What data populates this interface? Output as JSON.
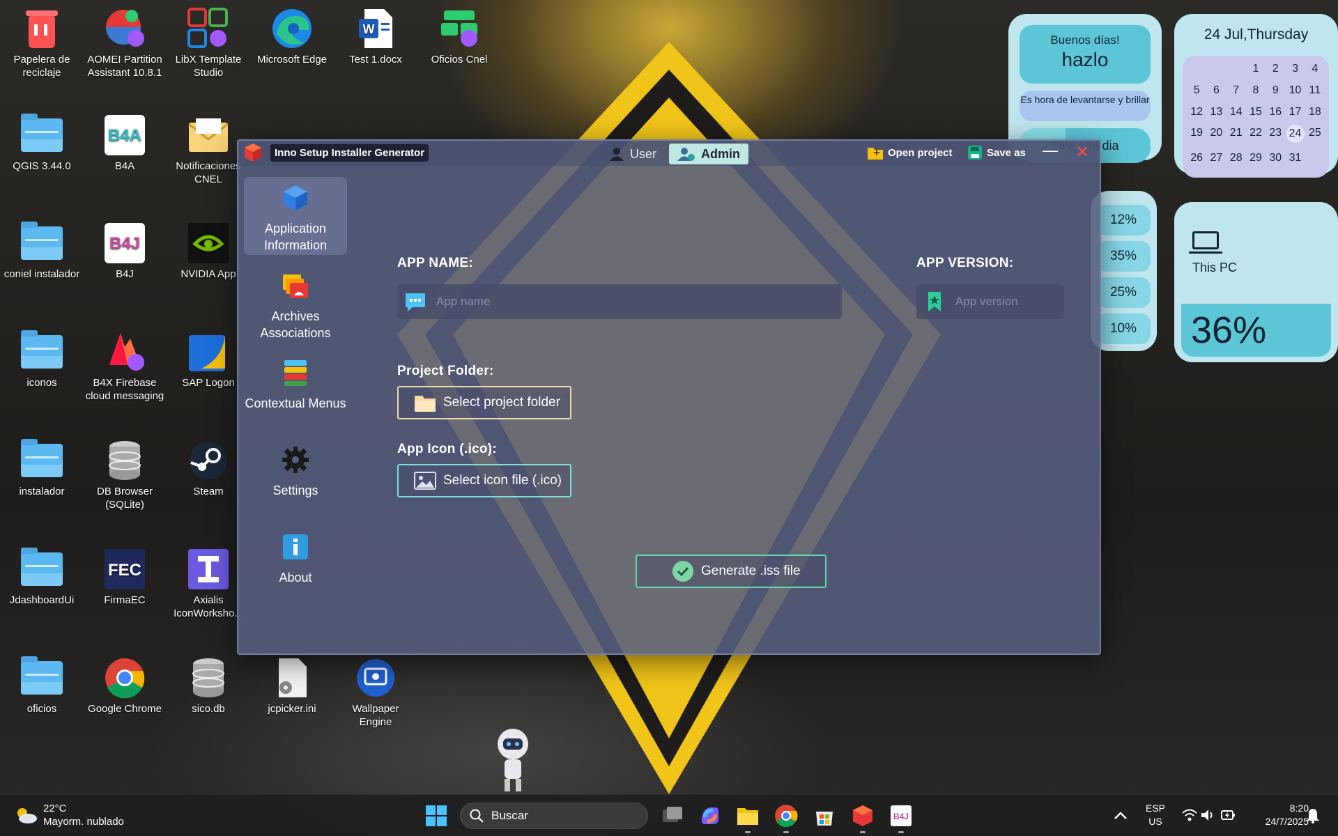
{
  "desktop": {
    "icons": [
      {
        "label": "Papelera de reciclaje",
        "icon": "recycle-bin-icon"
      },
      {
        "label": "AOMEI Partition Assistant 10.8.1",
        "icon": "aomei-icon"
      },
      {
        "label": "LibX Template Studio",
        "icon": "libx-icon"
      },
      {
        "label": "Microsoft Edge",
        "icon": "edge-icon"
      },
      {
        "label": "Test 1.docx",
        "icon": "word-doc-icon"
      },
      {
        "label": "Oficios Cnel",
        "icon": "oficios-app-icon"
      },
      {
        "label": "QGIS 3.44.0",
        "icon": "folder-icon"
      },
      {
        "label": "B4A",
        "icon": "b4a-icon"
      },
      {
        "label": "Notificaciones CNEL",
        "icon": "mail-icon"
      },
      {
        "label": "coniel instalador",
        "icon": "folder-icon"
      },
      {
        "label": "B4J",
        "icon": "b4j-icon"
      },
      {
        "label": "NVIDIA App",
        "icon": "nvidia-icon"
      },
      {
        "label": "iconos",
        "icon": "folder-icon"
      },
      {
        "label": "B4X Firebase cloud messaging",
        "icon": "firebase-icon"
      },
      {
        "label": "SAP Logon",
        "icon": "sap-icon"
      },
      {
        "label": "instalador",
        "icon": "folder-icon"
      },
      {
        "label": "DB Browser (SQLite)",
        "icon": "database-icon"
      },
      {
        "label": "Steam",
        "icon": "steam-icon"
      },
      {
        "label": "JdashboardUi",
        "icon": "folder-icon"
      },
      {
        "label": "FirmaEC",
        "icon": "firmaec-icon"
      },
      {
        "label": "Axialis IconWorksho...",
        "icon": "axialis-icon"
      },
      {
        "label": "oficios",
        "icon": "folder-icon"
      },
      {
        "label": "Google Chrome",
        "icon": "chrome-icon"
      },
      {
        "label": "sico.db",
        "icon": "database-icon"
      },
      {
        "label": "jcpicker.ini",
        "icon": "ini-file-icon"
      },
      {
        "label": "Wallpaper Engine",
        "icon": "wallpaper-engine-icon"
      }
    ]
  },
  "widgets": {
    "greeting": {
      "line1": "Buenos días!",
      "line2": "hazlo",
      "line3": "Es hora de levantarse y brillar",
      "progress_label": "35% Del dia",
      "progress": 0.35
    },
    "calendar": {
      "header": "24 Jul,Thursday",
      "days": [
        "",
        "",
        "",
        "1",
        "2",
        "3",
        "4",
        "5",
        "6",
        "7",
        "8",
        "9",
        "10",
        "11",
        "12",
        "13",
        "14",
        "15",
        "16",
        "17",
        "18",
        "19",
        "20",
        "21",
        "22",
        "23",
        "24",
        "25",
        "26",
        "27",
        "28",
        "29",
        "30",
        "31"
      ],
      "today": "24"
    },
    "performance": {
      "values": [
        "12%",
        "35%",
        "25%",
        "10%"
      ]
    },
    "this_pc": {
      "label": "This PC",
      "value": "36%"
    }
  },
  "app": {
    "title": "Inno Setup Installer Generator",
    "modes": {
      "user": "User",
      "admin": "Admin",
      "active": "admin"
    },
    "actions": {
      "open_project": "Open project",
      "save_as": "Save as"
    },
    "window_controls": {
      "minimize": "—",
      "close": "✕"
    },
    "sidebar": [
      {
        "label": "Application Information",
        "icon": "cube-icon",
        "active": true
      },
      {
        "label": "Archives Associations",
        "icon": "files-icon",
        "active": false
      },
      {
        "label": "Contextual Menus",
        "icon": "stack-menu-icon",
        "active": false
      },
      {
        "label": "Settings",
        "icon": "gear-icon",
        "active": false
      },
      {
        "label": "About",
        "icon": "info-icon",
        "active": false
      }
    ],
    "form": {
      "app_name_label": "APP NAME:",
      "app_name_placeholder": "App name",
      "app_name_value": "",
      "app_version_label": "APP VERSION:",
      "app_version_placeholder": "App version",
      "app_version_value": "",
      "project_folder_label": "Project Folder:",
      "project_folder_button": "Select project folder",
      "app_icon_label": "App Icon (.ico):",
      "app_icon_button": "Select icon file (.ico)",
      "generate_button": "Generate .iss file"
    }
  },
  "taskbar": {
    "weather": {
      "temp": "22°C",
      "desc": "Mayorm. nublado"
    },
    "search_placeholder": "Buscar",
    "lang": {
      "line1": "ESP",
      "line2": "US"
    },
    "clock": {
      "time": "8:20",
      "date": "24/7/2025"
    }
  }
}
